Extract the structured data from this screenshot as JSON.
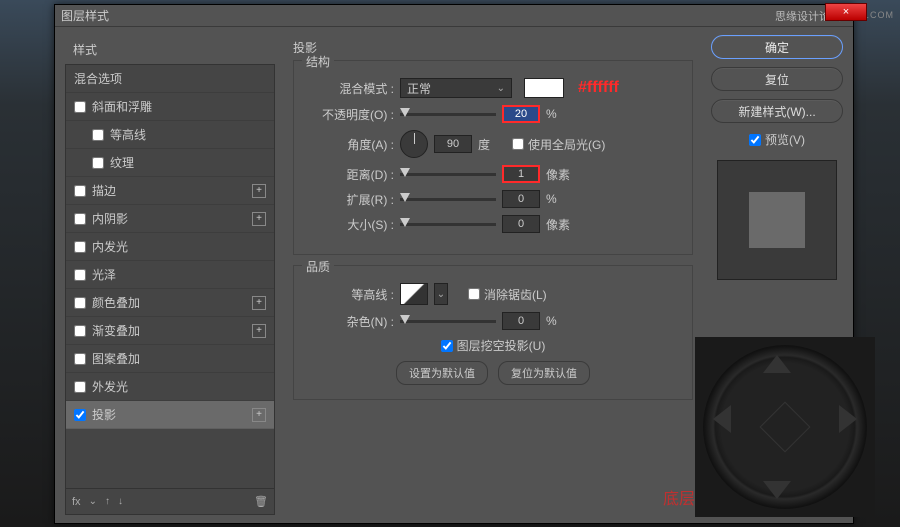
{
  "watermark": "WWW.MISSYUAN.COM",
  "title": "图层样式",
  "title_logo": "思缘设计论坛",
  "close": "×",
  "styles_header": "样式",
  "blend_opts": "混合选项",
  "effects": [
    {
      "label": "斜面和浮雕",
      "checked": false,
      "plus": false
    },
    {
      "label": "等高线",
      "checked": false,
      "plus": false,
      "indent": true
    },
    {
      "label": "纹理",
      "checked": false,
      "plus": false,
      "indent": true
    },
    {
      "label": "描边",
      "checked": false,
      "plus": true
    },
    {
      "label": "内阴影",
      "checked": false,
      "plus": true
    },
    {
      "label": "内发光",
      "checked": false,
      "plus": false
    },
    {
      "label": "光泽",
      "checked": false,
      "plus": false
    },
    {
      "label": "颜色叠加",
      "checked": false,
      "plus": true
    },
    {
      "label": "渐变叠加",
      "checked": false,
      "plus": true
    },
    {
      "label": "图案叠加",
      "checked": false,
      "plus": false
    },
    {
      "label": "外发光",
      "checked": false,
      "plus": false
    },
    {
      "label": "投影",
      "checked": true,
      "plus": true,
      "selected": true
    }
  ],
  "footer_fx": "fx",
  "main_title": "投影",
  "structure": {
    "legend": "结构",
    "blend_mode_lbl": "混合模式 :",
    "blend_mode_val": "正常",
    "color_annot": "#ffffff",
    "opacity_lbl": "不透明度(O) :",
    "opacity_val": "20",
    "opacity_unit": "%",
    "angle_lbl": "角度(A) :",
    "angle_val": "90",
    "angle_unit": "度",
    "global_light": "使用全局光(G)",
    "distance_lbl": "距离(D) :",
    "distance_val": "1",
    "distance_unit": "像素",
    "spread_lbl": "扩展(R) :",
    "spread_val": "0",
    "spread_unit": "%",
    "size_lbl": "大小(S) :",
    "size_val": "0",
    "size_unit": "像素"
  },
  "quality": {
    "legend": "品质",
    "contour_lbl": "等高线 :",
    "antialias": "消除锯齿(L)",
    "noise_lbl": "杂色(N) :",
    "noise_val": "0",
    "noise_unit": "%",
    "knockout": "图层挖空投影(U)",
    "set_default": "设置为默认值",
    "reset_default": "复位为默认值"
  },
  "right": {
    "ok": "确定",
    "reset": "复位",
    "new_style": "新建样式(W)...",
    "preview": "预览(V)"
  },
  "dpad_label": "底层"
}
